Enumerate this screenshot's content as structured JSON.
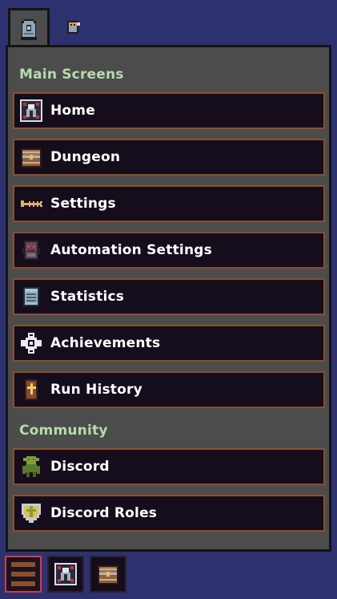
{
  "tabs": [
    {
      "icon": "gravestone-icon",
      "active": true
    },
    {
      "icon": "character-icon",
      "active": false
    }
  ],
  "sections": {
    "main_title": "Main Screens",
    "community_title": "Community"
  },
  "main_items": [
    {
      "label": "Home",
      "icon": "home-icon"
    },
    {
      "label": "Dungeon",
      "icon": "chest-icon"
    },
    {
      "label": "Settings",
      "icon": "wrench-icon"
    },
    {
      "label": "Automation Settings",
      "icon": "robot-icon"
    },
    {
      "label": "Statistics",
      "icon": "scroll-icon"
    },
    {
      "label": "Achievements",
      "icon": "medal-icon"
    },
    {
      "label": "Run History",
      "icon": "coffin-icon"
    }
  ],
  "community_items": [
    {
      "label": "Discord",
      "icon": "goblin-icon"
    },
    {
      "label": "Discord Roles",
      "icon": "shield-icon"
    }
  ],
  "bottom_bar": [
    {
      "icon": "hamburger-menu-icon",
      "active": true
    },
    {
      "icon": "home-icon",
      "active": false
    },
    {
      "icon": "chest-icon",
      "active": false
    }
  ],
  "colors": {
    "background": "#2e3170",
    "panel": "#4c4c4c",
    "button": "#150d1b",
    "button_border": "#8b4f2c",
    "section_title": "#b7dcaa",
    "active_border": "#d13b4b"
  }
}
